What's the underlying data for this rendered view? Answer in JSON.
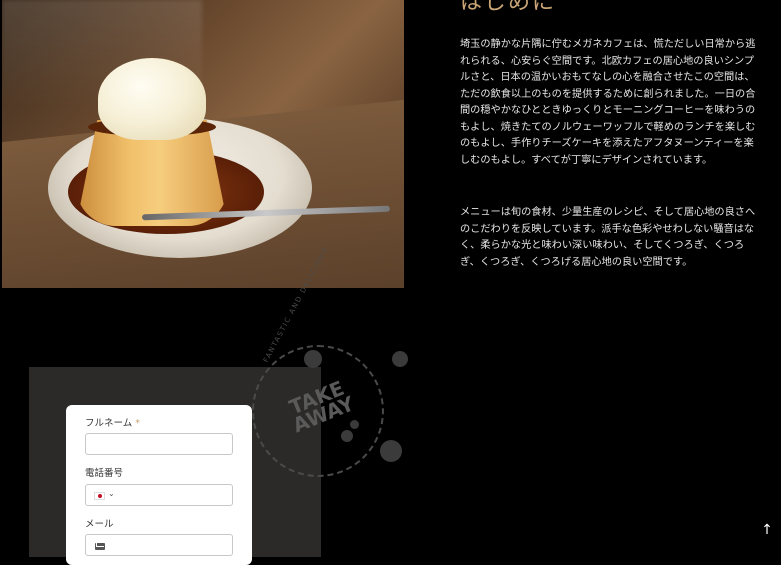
{
  "intro": {
    "heading": "はじめに",
    "paragraph1": "埼玉の静かな片隅に佇むメガネカフェは、慌ただしい日常から逃れられる、心安らぐ空間です。北欧カフェの居心地の良いシンプルさと、日本の温かいおもてなしの心を融合させたこの空間は、ただの飲食以上のものを提供するために創られました。一日の合間の穏やかなひとときゆっくりとモーニングコーヒーを味わうのもよし、焼きたてのノルウェーワッフルで軽めのランチを楽しむのもよし、手作りチーズケーキを添えたアフタヌーンティーを楽しむのもよし。すべてが丁寧にデザインされています。",
    "paragraph2": "メニューは旬の食材、少量生産のレシピ、そして居心地の良さへのこだわりを反映しています。派手な色彩やせわしない騒音はなく、柔らかな光と味わい深い味わい、そしてくつろぎ、くつろぎ、くつろぎ、くつろげる居心地の良い空間です。"
  },
  "badge": {
    "main_text_line1": "TAKE",
    "main_text_line2": "AWAY",
    "ring_text": "FANTASTIC AND DELICIOUS"
  },
  "form": {
    "fullname_label": "フルネーム",
    "required_mark": "*",
    "phone_label": "電話番号",
    "email_label": "メール"
  },
  "scroll_top": "↑"
}
